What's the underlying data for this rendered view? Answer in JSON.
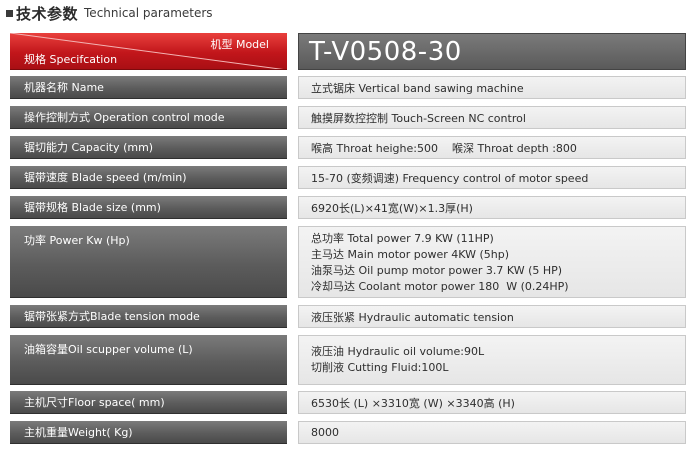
{
  "heading": {
    "cn": "技术参数",
    "en": "Technical parameters"
  },
  "header": {
    "model_label": "机型 Model",
    "spec_label": "规格 Specifcation",
    "model_value": "T-V0508-30"
  },
  "rows": [
    {
      "label": "机器名称 Name",
      "lines": [
        "立式锯床 Vertical band sawing machine"
      ]
    },
    {
      "label": "操作控制方式 Operation control mode",
      "lines": [
        "触摸屏数控控制 Touch-Screen NC control"
      ]
    },
    {
      "label": "锯切能力 Capacity (mm)",
      "lines": [
        "喉高 Throat heighe:500    喉深 Throat depth :800"
      ]
    },
    {
      "label": "锯带速度 Blade speed (m/min)",
      "lines": [
        "15-70 (变频调速) Frequency control of motor speed"
      ]
    },
    {
      "label": "锯带规格 Blade size (mm)",
      "lines": [
        "6920长(L)×41宽(W)×1.3厚(H)"
      ]
    },
    {
      "label": "功率 Power Kw (Hp)",
      "lines": [
        "总功率 Total power 7.9 KW (11HP)",
        "主马达 Main motor power 4KW (5hp)",
        "油泵马达 Oil pump motor power 3.7 KW (5 HP)",
        "冷却马达 Coolant motor power 180  W (0.24HP)"
      ]
    },
    {
      "label": "锯带张紧方式Blade tension mode",
      "lines": [
        "液压张紧 Hydraulic automatic tension"
      ]
    },
    {
      "label": "油箱容量Oil scupper volume (L)",
      "lines": [
        "液压油 Hydraulic oil volume:90L",
        "切削液 Cutting Fluid:100L"
      ]
    },
    {
      "label": "主机尺寸Floor space( mm)",
      "lines": [
        "6530长 (L) ×3310宽 (W) ×3340高 (H)"
      ]
    },
    {
      "label": "主机重量Weight( Kg)",
      "lines": [
        "8000"
      ]
    }
  ]
}
